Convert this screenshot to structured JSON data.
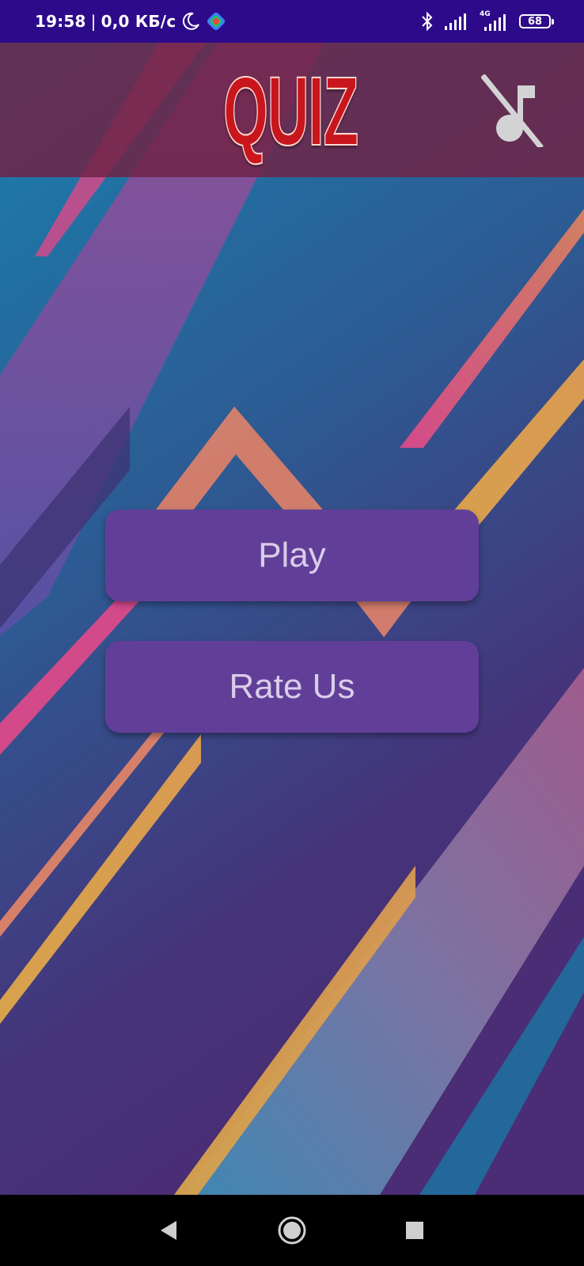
{
  "status_bar": {
    "time": "19:58",
    "separator": "|",
    "net_speed": "0,0 КБ/с",
    "network_type": "4G",
    "battery_level": "68",
    "icons": [
      "moon-icon",
      "app-notification-icon",
      "bluetooth-icon",
      "signal-icon",
      "signal-4g-icon",
      "battery-icon"
    ],
    "background_color": "#2d0a8a"
  },
  "header": {
    "logo_text": "QUIZ",
    "logo_color": "#c8161c",
    "background_color": "#6e2446",
    "music_toggle_icon": "music-off-icon"
  },
  "menu": {
    "play_label": "Play",
    "rate_label": "Rate Us",
    "button_color": "#613f98",
    "label_color": "#d9cde9"
  },
  "navigation_bar": {
    "icons": [
      "back-icon",
      "home-icon",
      "recents-icon"
    ]
  }
}
